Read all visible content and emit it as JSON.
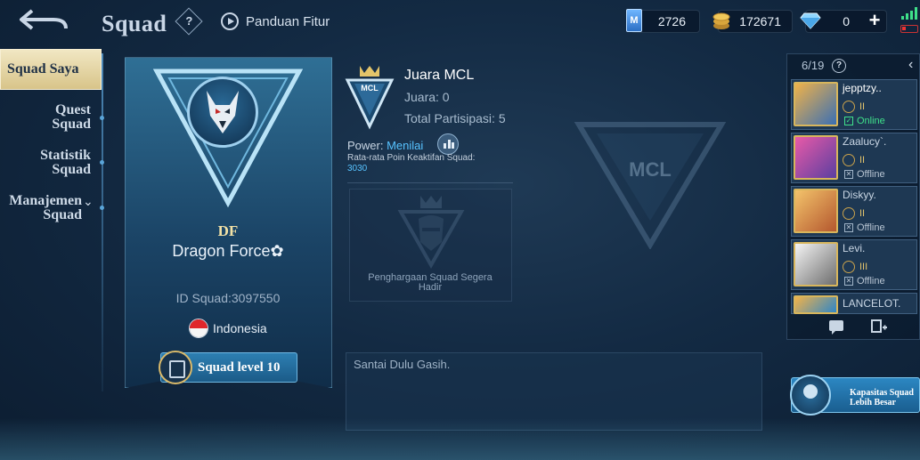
{
  "header": {
    "title": "Squad",
    "help_symbol": "?",
    "guide_label": "Panduan Fitur"
  },
  "currencies": {
    "mcoin_symbol": "M",
    "mcoin_value": "2726",
    "gold_value": "172671",
    "diamond_value": "0",
    "plus_symbol": "+"
  },
  "nav": {
    "active": "Squad Saya",
    "quest_line1": "Quest",
    "quest_line2": "Squad",
    "stats_line1": "Statistik",
    "stats_line2": "Squad",
    "manage_line1": "Manajemen",
    "manage_line2": "Squad",
    "manage_chevron": "⌄"
  },
  "squad": {
    "tag": "DF",
    "name": "Dragon Force✿",
    "id_text": "ID Squad:3097550",
    "country": "Indonesia",
    "level_label": "Squad level 10"
  },
  "mcl": {
    "badge_text": "MCL",
    "title": "Juara MCL",
    "champion": "Juara: 0",
    "total": "Total Partisipasi: 5",
    "bg_text": "MCL"
  },
  "power": {
    "label": "Power: ",
    "value": "Menilai",
    "rating_label": "Rata-rata Poin Keaktifan Squad:",
    "rating_value": "3030"
  },
  "reward": {
    "text": "Penghargaan Squad Segera Hadir"
  },
  "notice": {
    "text": "Santai Dulu Gasih."
  },
  "members": {
    "count": "6/19",
    "help_symbol": "?",
    "collapse_symbol": "‹",
    "list": [
      {
        "name": "jepptzy..",
        "rank": "II",
        "status": "Online",
        "status_mark": "✓",
        "status_color": "#3fe08a"
      },
      {
        "name": "Zaalucy`.",
        "rank": "II",
        "status": "Offline",
        "status_mark": "✕",
        "status_color": "#b7c4d2"
      },
      {
        "name": "Diskyy.",
        "rank": "II",
        "status": "Offline",
        "status_mark": "✕",
        "status_color": "#b7c4d2"
      },
      {
        "name": "Levi.",
        "rank": "III",
        "status": "Offline",
        "status_mark": "✕",
        "status_color": "#b7c4d2"
      },
      {
        "name": "LANCELOT.",
        "rank": "",
        "status": "",
        "status_mark": "",
        "status_color": "#b7c4d2"
      }
    ]
  },
  "capacity": {
    "line1": "Kapasitas Squad",
    "line2": "Lebih Besar"
  },
  "colors": {
    "accent_blue": "#57c3ff",
    "online_green": "#3fe08a",
    "gold": "#d8b65c"
  }
}
